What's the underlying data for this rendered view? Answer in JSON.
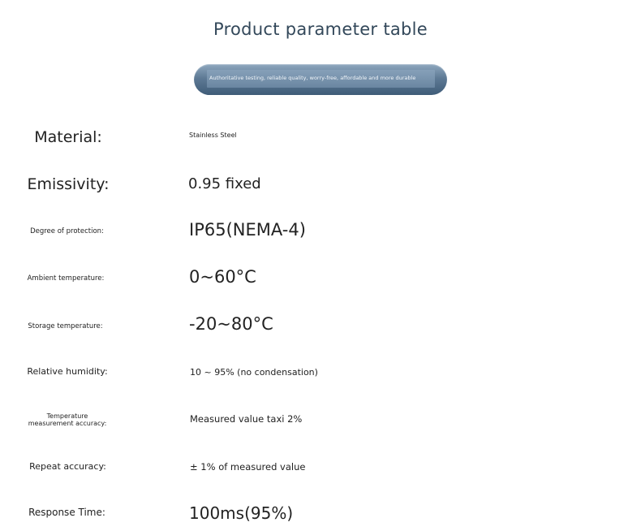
{
  "title": "Product parameter table",
  "banner": {
    "text": "Authoritative testing, reliable quality, worry-free, affordable and more durable"
  },
  "parameters": [
    {
      "label": "Material:",
      "value": "Stainless Steel"
    },
    {
      "label": "Emissivity:",
      "value": "0.95 fixed"
    },
    {
      "label": "Degree of protection:",
      "value": "IP65(NEMA-4)"
    },
    {
      "label": "Ambient temperature:",
      "value": "0~60°C"
    },
    {
      "label": "Storage temperature:",
      "value": "-20~80°C"
    },
    {
      "label": "Relative humidity:",
      "value": "10 ~ 95% (no condensation)"
    },
    {
      "label_line1": "Temperature",
      "label_line2": "measurement accuracy:",
      "value": "Measured value taxi 2%"
    },
    {
      "label": "Repeat accuracy:",
      "value": "± 1% of measured value"
    },
    {
      "label": "Response Time:",
      "value": "100ms(95%)"
    }
  ]
}
